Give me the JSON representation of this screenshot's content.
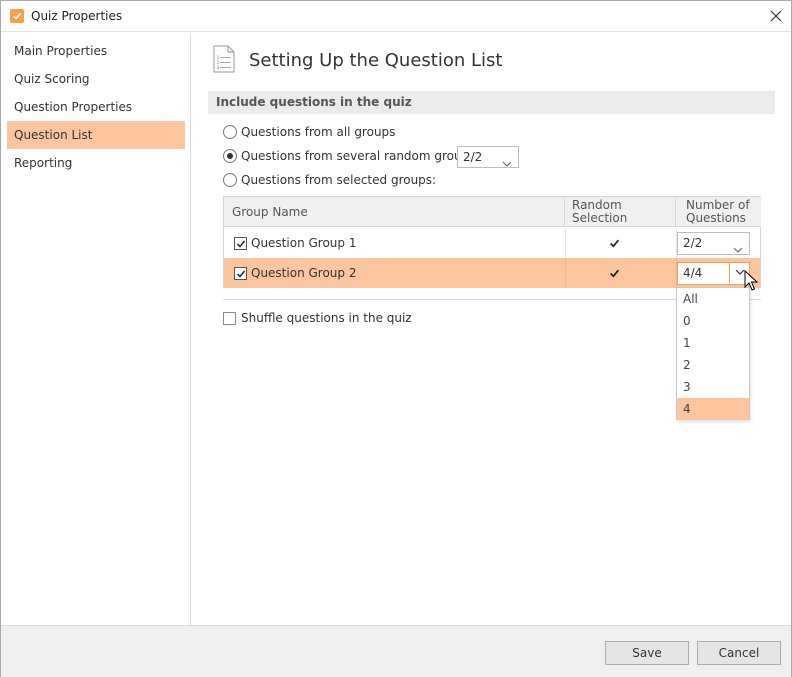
{
  "window": {
    "title": "Quiz Properties"
  },
  "sidebar": {
    "items": [
      {
        "label": "Main Properties"
      },
      {
        "label": "Quiz Scoring"
      },
      {
        "label": "Question Properties"
      },
      {
        "label": "Question List"
      },
      {
        "label": "Reporting"
      }
    ],
    "active_index": 3
  },
  "main": {
    "title": "Setting Up the Question List",
    "section_header": "Include questions in the quiz",
    "radios": [
      {
        "label": "Questions from all groups",
        "checked": false
      },
      {
        "label": "Questions from several random groups:",
        "checked": true
      },
      {
        "label": "Questions from selected groups:",
        "checked": false
      }
    ],
    "random_groups_value": "2/2",
    "table": {
      "headers": {
        "group_name": "Group Name",
        "random_line1": "Random",
        "random_line2": "Selection",
        "number_line1": "Number of",
        "number_line2": "Questions"
      },
      "rows": [
        {
          "name": "Question Group 1",
          "included": true,
          "random": true,
          "number": "2/2",
          "selected": false
        },
        {
          "name": "Question Group 2",
          "included": true,
          "random": true,
          "number": "4/4",
          "selected": true
        }
      ]
    },
    "shuffle_label": "Shuffle questions in the quiz",
    "shuffle_checked": false,
    "dropdown": {
      "options": [
        "All",
        "0",
        "1",
        "2",
        "3",
        "4"
      ],
      "selected": "4"
    }
  },
  "footer": {
    "save_label": "Save",
    "cancel_label": "Cancel"
  },
  "colors": {
    "accent": "#f5a04b",
    "selection": "#fcc59d",
    "footer_bg": "#f0f0f0"
  }
}
